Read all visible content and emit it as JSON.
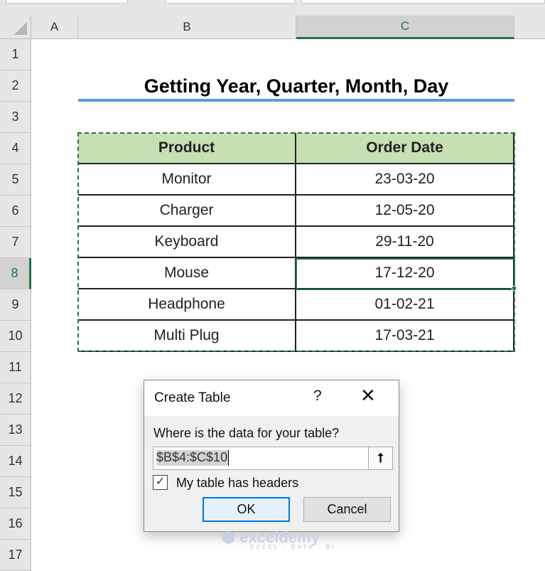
{
  "columns": [
    "A",
    "B",
    "C"
  ],
  "rows": [
    "1",
    "2",
    "3",
    "4",
    "5",
    "6",
    "7",
    "8",
    "9",
    "10",
    "11",
    "12",
    "13",
    "14",
    "15",
    "16",
    "17"
  ],
  "title": "Getting Year, Quarter, Month, Day",
  "table": {
    "headers": [
      "Product",
      "Order Date"
    ],
    "data": [
      [
        "Monitor",
        "23-03-20"
      ],
      [
        "Charger",
        "12-05-20"
      ],
      [
        "Keyboard",
        "29-11-20"
      ],
      [
        "Mouse",
        "17-12-20"
      ],
      [
        "Headphone",
        "01-02-21"
      ],
      [
        "Multi Plug",
        "17-03-21"
      ]
    ]
  },
  "dialog": {
    "title": "Create Table",
    "help": "?",
    "close": "✕",
    "prompt": "Where is the data for your table?",
    "range": "$B$4:$C$10",
    "collapse_icon": "⭡",
    "checkbox_label": "My table has headers",
    "checked": true,
    "ok": "OK",
    "cancel": "Cancel"
  },
  "watermark": {
    "name": "exceldemy",
    "tagline": "EXCEL · DATA · BI"
  },
  "colors": {
    "header_fill": "#c6e0b4",
    "accent": "#217346",
    "title_underline": "#5b9bd5"
  }
}
